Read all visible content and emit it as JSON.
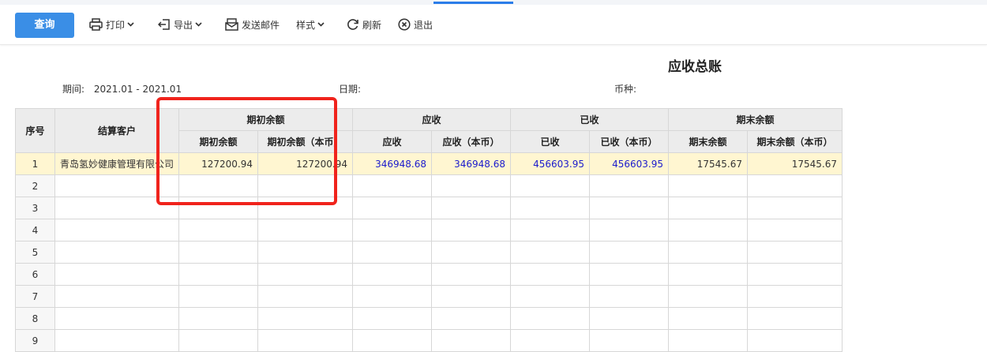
{
  "toolbar": {
    "query_label": "查询",
    "print_label": "打印",
    "export_label": "导出",
    "email_label": "发送邮件",
    "style_label": "样式",
    "refresh_label": "刷新",
    "exit_label": "退出"
  },
  "report": {
    "title": "应收总账",
    "period_label": "期间:",
    "period_value": "2021.01 - 2021.01",
    "date_label": "日期:",
    "currency_label": "币种:"
  },
  "table": {
    "header_groups": {
      "seq": "序号",
      "customer": "结算客户",
      "opening": "期初余额",
      "receivable": "应收",
      "received": "已收",
      "closing": "期末余额"
    },
    "sub_headers": [
      "期初余额",
      "期初余额（本币）",
      "应收",
      "应收（本币）",
      "已收",
      "已收（本币）",
      "期末余额",
      "期末余额（本币）"
    ],
    "rows": [
      {
        "seq": "1",
        "customer": "青岛氢妙健康管理有限公司",
        "opening": "127200.94",
        "opening_local": "127200.94",
        "receivable": "346948.68",
        "receivable_local": "346948.68",
        "received": "456603.95",
        "received_local": "456603.95",
        "closing": "17545.67",
        "closing_local": "17545.67"
      },
      {
        "seq": "2",
        "customer": "",
        "opening": "",
        "opening_local": "",
        "receivable": "",
        "receivable_local": "",
        "received": "",
        "received_local": "",
        "closing": "",
        "closing_local": ""
      },
      {
        "seq": "3",
        "customer": "",
        "opening": "",
        "opening_local": "",
        "receivable": "",
        "receivable_local": "",
        "received": "",
        "received_local": "",
        "closing": "",
        "closing_local": ""
      },
      {
        "seq": "4",
        "customer": "",
        "opening": "",
        "opening_local": "",
        "receivable": "",
        "receivable_local": "",
        "received": "",
        "received_local": "",
        "closing": "",
        "closing_local": ""
      },
      {
        "seq": "5",
        "customer": "",
        "opening": "",
        "opening_local": "",
        "receivable": "",
        "receivable_local": "",
        "received": "",
        "received_local": "",
        "closing": "",
        "closing_local": ""
      },
      {
        "seq": "6",
        "customer": "",
        "opening": "",
        "opening_local": "",
        "receivable": "",
        "receivable_local": "",
        "received": "",
        "received_local": "",
        "closing": "",
        "closing_local": ""
      },
      {
        "seq": "7",
        "customer": "",
        "opening": "",
        "opening_local": "",
        "receivable": "",
        "receivable_local": "",
        "received": "",
        "received_local": "",
        "closing": "",
        "closing_local": ""
      },
      {
        "seq": "8",
        "customer": "",
        "opening": "",
        "opening_local": "",
        "receivable": "",
        "receivable_local": "",
        "received": "",
        "received_local": "",
        "closing": "",
        "closing_local": ""
      },
      {
        "seq": "9",
        "customer": "",
        "opening": "",
        "opening_local": "",
        "receivable": "",
        "receivable_local": "",
        "received": "",
        "received_local": "",
        "closing": "",
        "closing_local": ""
      }
    ]
  },
  "colors": {
    "primary_button": "#3a8ee6",
    "highlight_row": "#fff6d1",
    "blue_value": "#1a1acc",
    "annotation_box": "#f0231c"
  }
}
